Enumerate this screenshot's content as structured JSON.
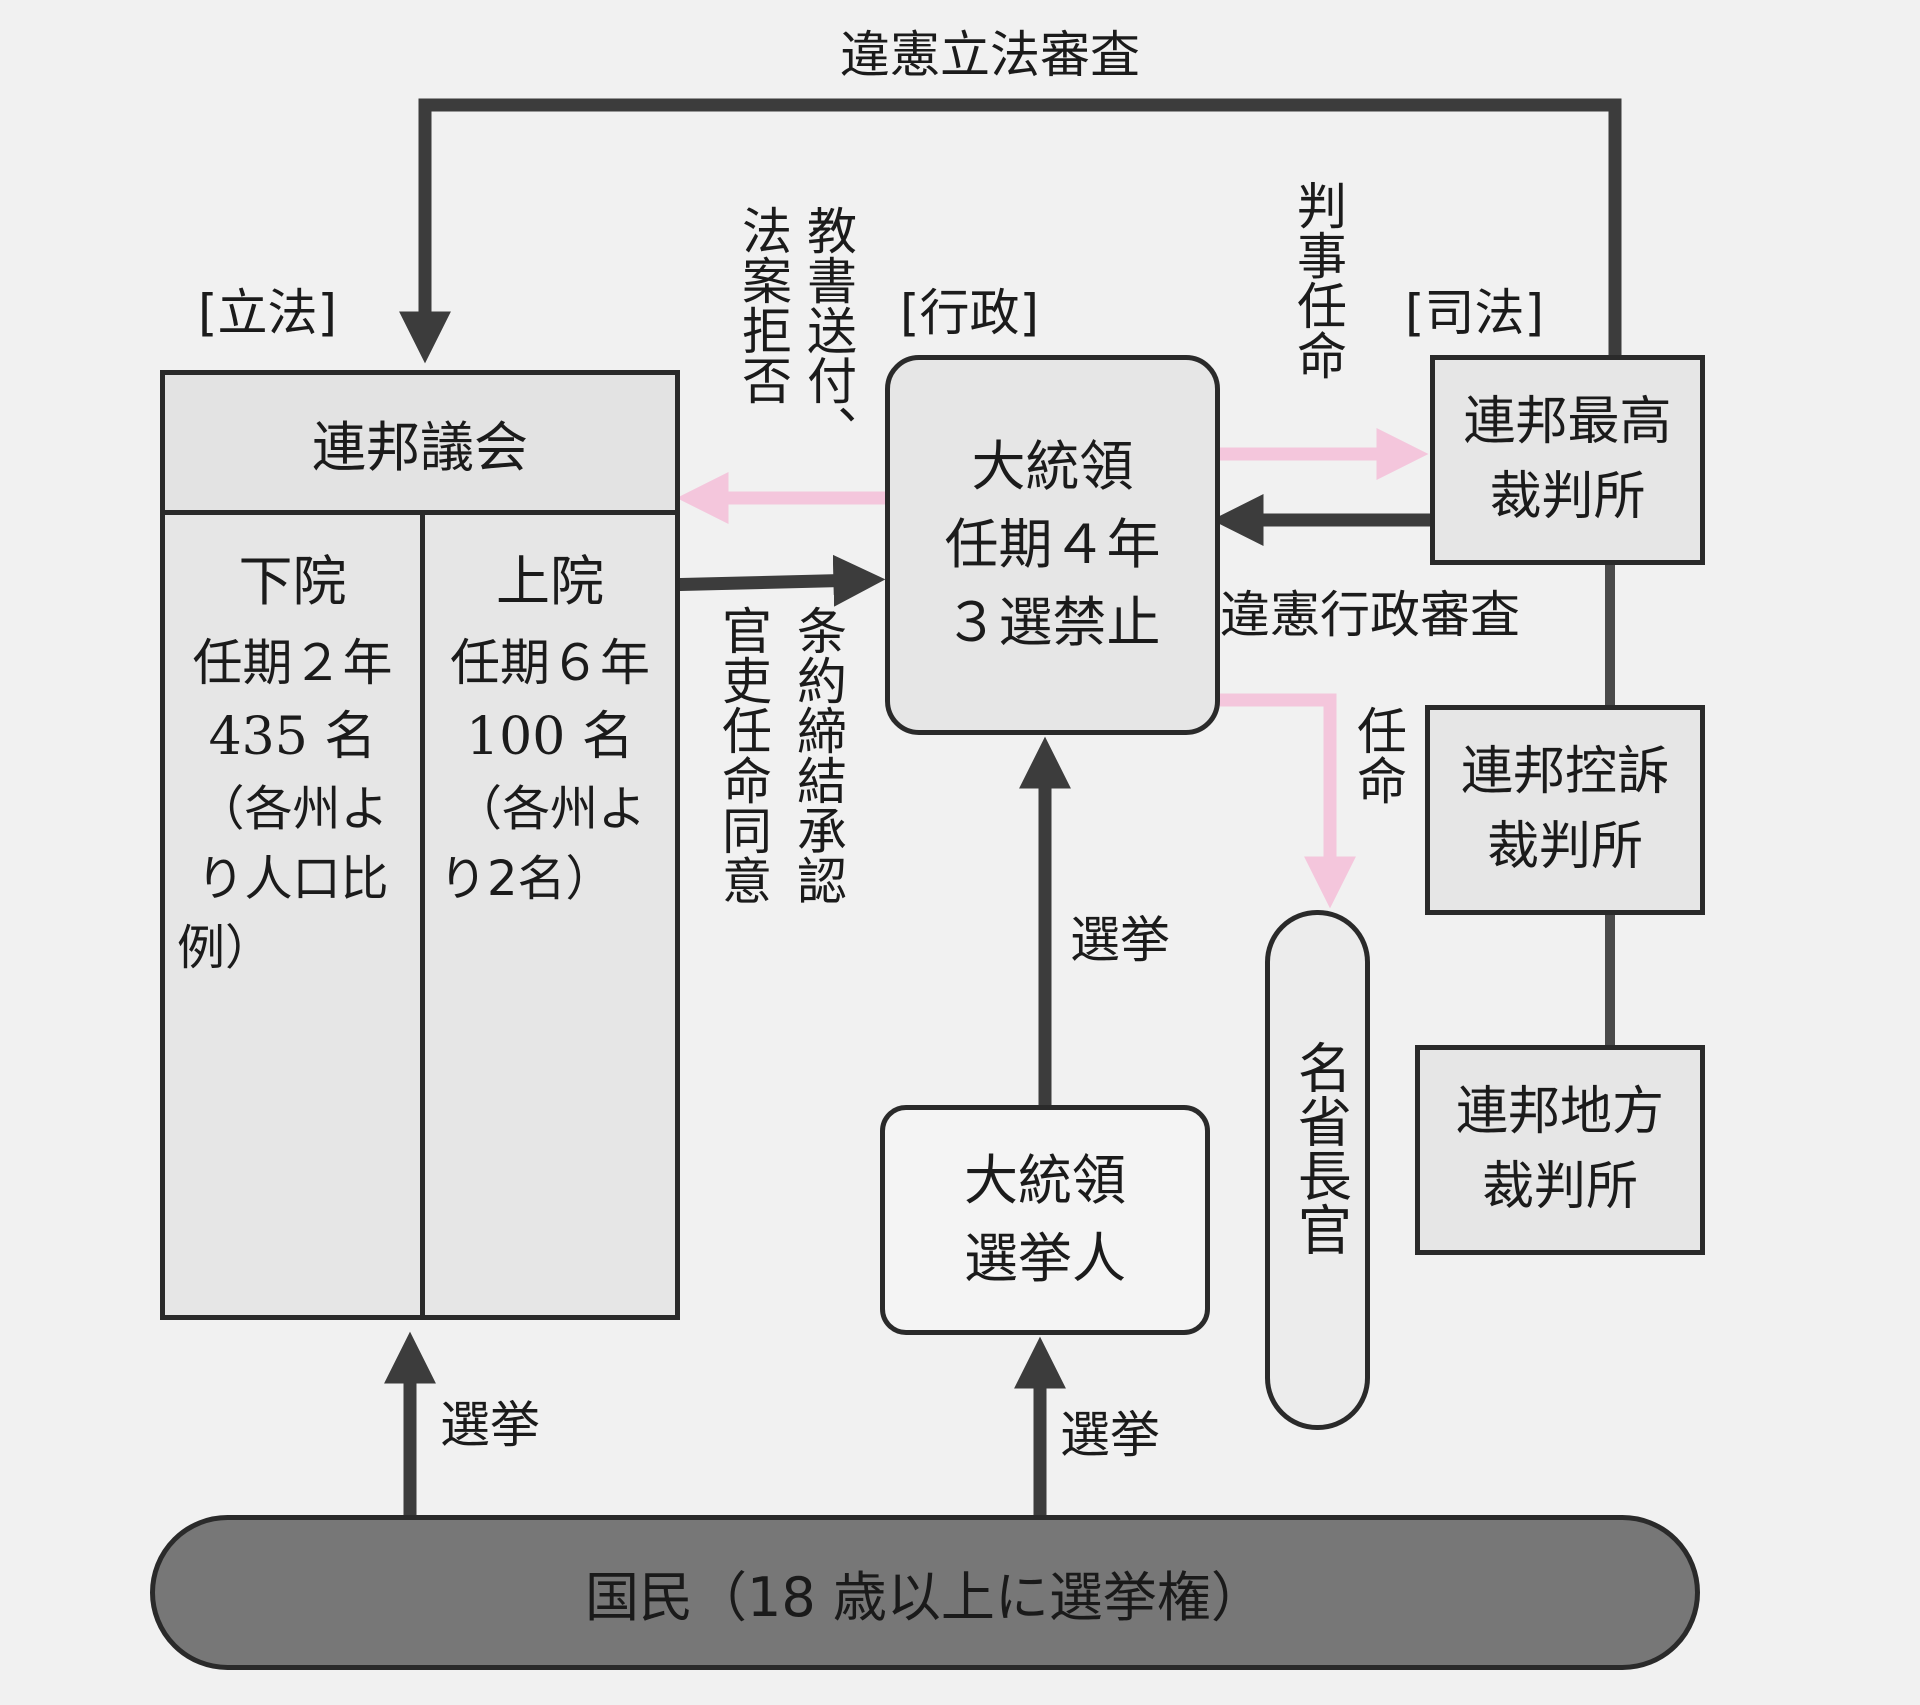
{
  "top_label": "違憲立法審査",
  "branches": {
    "legislative": "[立法]",
    "executive": "[行政]",
    "judicial": "[司法]"
  },
  "congress": {
    "title": "連邦議会",
    "house": {
      "name": "下院",
      "term": "任期２年",
      "seats": "435 名",
      "note1": "（各州よ",
      "note2": "り人口比",
      "note3": "例）"
    },
    "senate": {
      "name": "上院",
      "term": "任期６年",
      "seats": "100 名",
      "note1": "（各州よ",
      "note2": "り2名）"
    }
  },
  "president": {
    "line1": "大統領",
    "line2": "任期４年",
    "line3": "３選禁止"
  },
  "electors": {
    "line1": "大統領",
    "line2": "選挙人"
  },
  "secretaries": "名省長官",
  "courts": {
    "supreme": [
      "連邦最高",
      "裁判所"
    ],
    "appeals": [
      "連邦控訴",
      "裁判所"
    ],
    "district": [
      "連邦地方",
      "裁判所"
    ]
  },
  "people": "国民（18 歳以上に選挙権）",
  "labels": {
    "veto": "教書送付、",
    "veto2": "法案拒否",
    "treaty": "条約締結承認",
    "appointment_consent": "官吏任命同意",
    "judge_appointment": "判事任命",
    "exec_review": "違憲行政審査",
    "appoint": "任命",
    "election_pres": "選挙",
    "election_left": "選挙",
    "election_mid": "選挙"
  },
  "colors": {
    "dark_arrow": "#3c3c3c",
    "pink_arrow": "#f4c6dc",
    "box_fill": "#e6e6e6",
    "people_fill": "#777777"
  }
}
